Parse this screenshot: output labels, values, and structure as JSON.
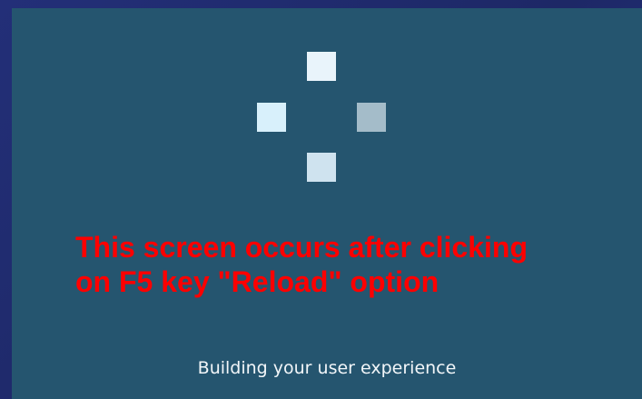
{
  "loader": {
    "icon": "loading-squares",
    "colors": {
      "panel_background": "#25556f",
      "square_top": "#e9f4fb",
      "square_left": "#d8f0fb",
      "square_right": "#a4bcc9",
      "square_bottom": "#cfe3ef"
    }
  },
  "annotation": {
    "line1": "This screen occurs after clicking",
    "line2": "on F5 key \"Reload\" option",
    "color": "#ff0000"
  },
  "status": {
    "text": "Building your user experience"
  }
}
